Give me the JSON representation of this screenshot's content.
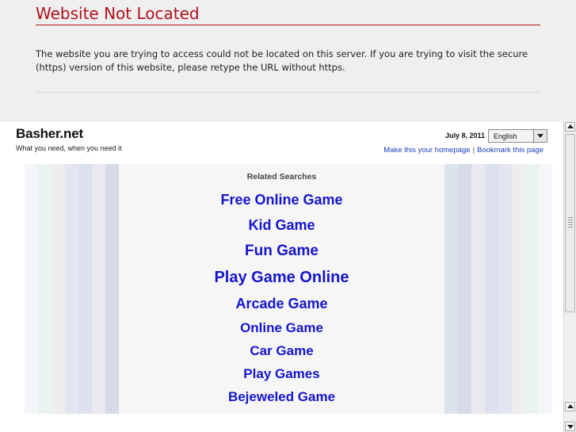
{
  "error": {
    "title": "Website Not Located",
    "message": "The website you are trying to access could not be located on this server. If you are trying to visit the secure (https) version of this website, please retype the URL without https."
  },
  "site": {
    "logo": "Basher.net",
    "tagline": "What you need, when you need it",
    "date": "July 8, 2011",
    "language": "English",
    "homepage_link": "Make this your homepage",
    "bookmark_link": "Bookmark this page"
  },
  "related": {
    "title": "Related Searches",
    "links": [
      "Free Online Game",
      "Kid Game",
      "Fun Game",
      "Play Game Online",
      "Arcade Game",
      "Online Game",
      "Car Game",
      "Play Games",
      "Bejeweled Game"
    ]
  },
  "colors": {
    "error_red": "#b0101a",
    "link_blue": "#1515cc",
    "left_stripes": [
      "#f4f6fa",
      "#eaf4ee",
      "#eeeeee",
      "#e3e6f0",
      "#dde0ee",
      "#e9e9ef",
      "#d7dbe8",
      "#dde3ec"
    ],
    "right_stripes": [
      "#dde3ec",
      "#d7dbe8",
      "#e9e9ef",
      "#dde0ee",
      "#e3e6f0",
      "#eeeeee",
      "#eaf4ee",
      "#f4f6fa"
    ]
  }
}
